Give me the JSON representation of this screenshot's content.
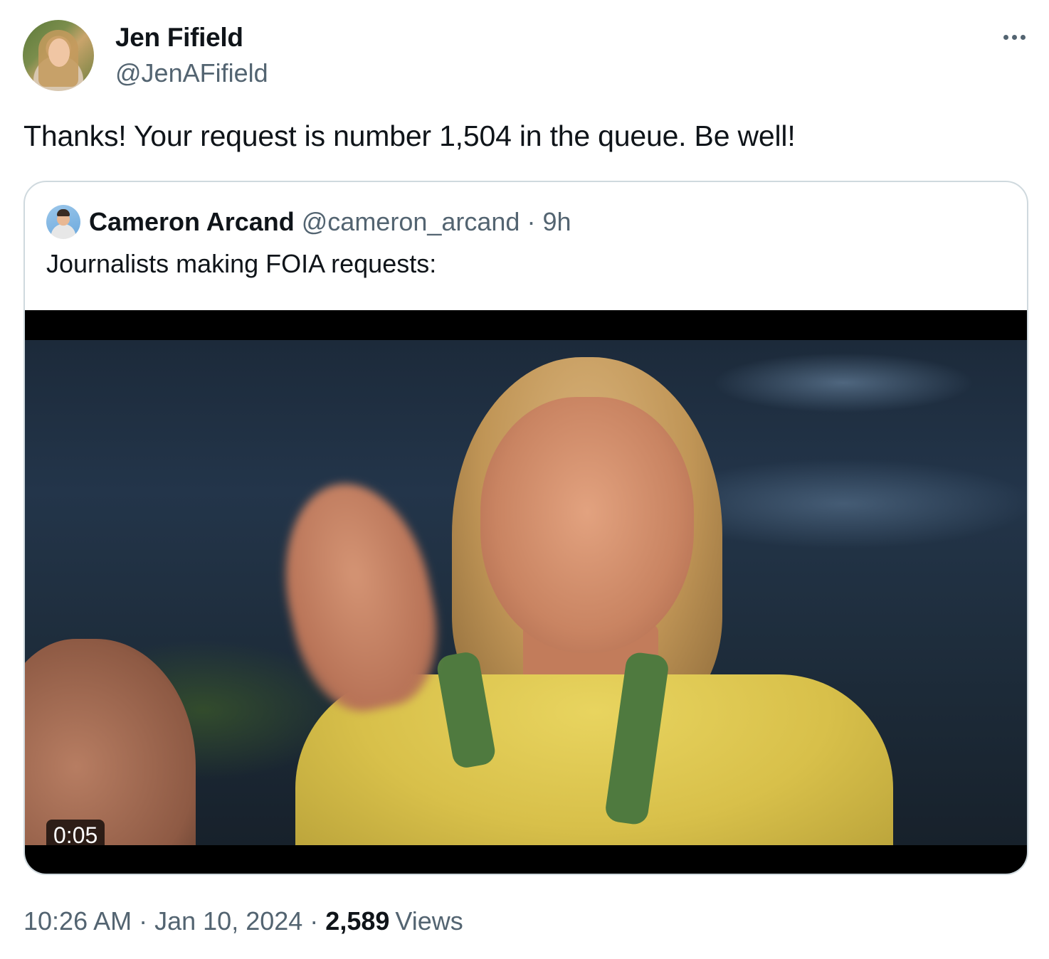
{
  "author": {
    "display_name": "Jen Fifield",
    "handle": "@JenAFifield"
  },
  "tweet": {
    "text": "Thanks! Your request is number 1,504 in the queue. Be well!",
    "time": "10:26 AM",
    "date": "Jan 10, 2024",
    "separator": "·",
    "views_count": "2,589",
    "views_label": "Views"
  },
  "quoted_tweet": {
    "display_name": "Cameron Arcand",
    "handle": "@cameron_arcand",
    "separator": "·",
    "age": "9h",
    "text": "Journalists making FOIA requests:",
    "video": {
      "duration": "0:05"
    }
  },
  "icons": {
    "more": "more-horizontal-icon"
  },
  "colors": {
    "text_primary": "#0f1419",
    "text_secondary": "#536471",
    "border": "#cfd9de"
  }
}
